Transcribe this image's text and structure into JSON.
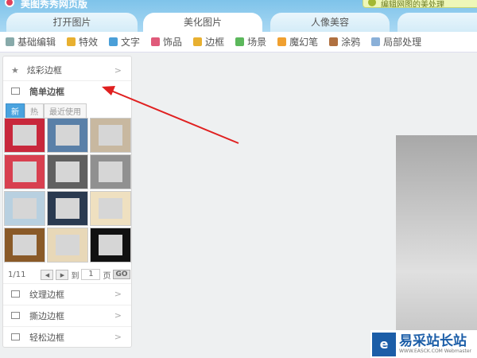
{
  "app": {
    "title": "美图秀秀网页版",
    "notice": "编辑网图的美处理"
  },
  "tabs": [
    "打开图片",
    "美化图片",
    "人像美容"
  ],
  "toolbar": [
    {
      "label": "基础编辑",
      "color": "#8aa"
    },
    {
      "label": "特效",
      "color": "#e8b030"
    },
    {
      "label": "文字",
      "color": "#4a9fd8"
    },
    {
      "label": "饰品",
      "color": "#e05a7a"
    },
    {
      "label": "边框",
      "color": "#e8b030"
    },
    {
      "label": "场景",
      "color": "#5cb85c"
    },
    {
      "label": "魔幻笔",
      "color": "#f0a030"
    },
    {
      "label": "涂鸦",
      "color": "#b07040"
    },
    {
      "label": "局部处理",
      "color": "#8ab0d8"
    }
  ],
  "panel": {
    "fancy": "炫彩边框",
    "simple": "简单边框",
    "filters": [
      "新",
      "热",
      "最近使用"
    ],
    "pager": {
      "page": "1/11",
      "to": "到",
      "value": "1",
      "unit": "页",
      "go": "GO"
    },
    "bottom": [
      "纹理边框",
      "撕边边框",
      "轻松边框"
    ],
    "chevron": ">"
  },
  "thumb_colors": [
    "#c8283c",
    "#5a80a8",
    "#c8b8a0",
    "#d84050",
    "#606060",
    "#909090",
    "#b8d0e0",
    "#2a3a50",
    "#efe0c0",
    "#8a5a28",
    "#e8d8b8",
    "#111111"
  ],
  "watermark": {
    "logo": "e",
    "name": "易采站长站",
    "sub": "WWW.EASCK.COM Webmaster"
  }
}
